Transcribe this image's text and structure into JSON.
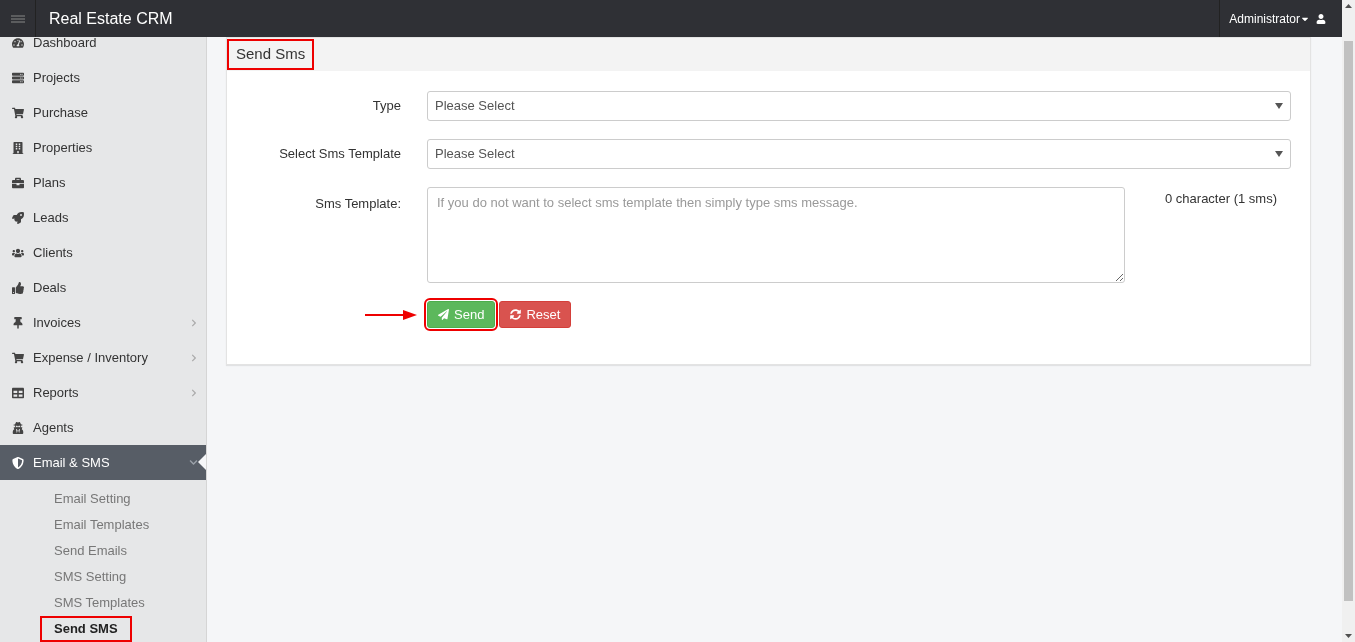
{
  "header": {
    "brand": "Real Estate CRM",
    "user": "Administrator"
  },
  "sidebar": {
    "items": [
      {
        "label": "Dashboard",
        "has_submenu": false,
        "expanded": false
      },
      {
        "label": "Projects",
        "has_submenu": false,
        "expanded": false
      },
      {
        "label": "Purchase",
        "has_submenu": false,
        "expanded": false
      },
      {
        "label": "Properties",
        "has_submenu": false,
        "expanded": false
      },
      {
        "label": "Plans",
        "has_submenu": false,
        "expanded": false
      },
      {
        "label": "Leads",
        "has_submenu": false,
        "expanded": false
      },
      {
        "label": "Clients",
        "has_submenu": false,
        "expanded": false
      },
      {
        "label": "Deals",
        "has_submenu": false,
        "expanded": false
      },
      {
        "label": "Invoices",
        "has_submenu": true,
        "expanded": false
      },
      {
        "label": "Expense / Inventory",
        "has_submenu": true,
        "expanded": false
      },
      {
        "label": "Reports",
        "has_submenu": true,
        "expanded": false
      },
      {
        "label": "Agents",
        "has_submenu": false,
        "expanded": false
      },
      {
        "label": "Email & SMS",
        "has_submenu": true,
        "expanded": true,
        "children": [
          {
            "label": "Email Setting",
            "selected": false,
            "highlighted": false
          },
          {
            "label": "Email Templates",
            "selected": false,
            "highlighted": false
          },
          {
            "label": "Send Emails",
            "selected": false,
            "highlighted": false
          },
          {
            "label": "SMS Setting",
            "selected": false,
            "highlighted": false
          },
          {
            "label": "SMS Templates",
            "selected": false,
            "highlighted": false
          },
          {
            "label": "Send SMS",
            "selected": true,
            "highlighted": true
          }
        ]
      }
    ]
  },
  "panel": {
    "title": "Send Sms",
    "title_highlighted": true,
    "fields": [
      {
        "kind": "select",
        "label": "Type",
        "value": "Please Select"
      },
      {
        "kind": "select",
        "label": "Select Sms Template",
        "value": "Please Select"
      },
      {
        "kind": "textarea",
        "label": "Sms Template:",
        "placeholder": "If you do not want to select sms template then simply type sms message.",
        "counter": "0 character (1 sms)"
      }
    ],
    "buttons": [
      {
        "kind": "send",
        "label": "Send",
        "highlighted": true,
        "arrow": true
      },
      {
        "kind": "reset",
        "label": "Reset",
        "highlighted": false,
        "arrow": false
      }
    ]
  }
}
